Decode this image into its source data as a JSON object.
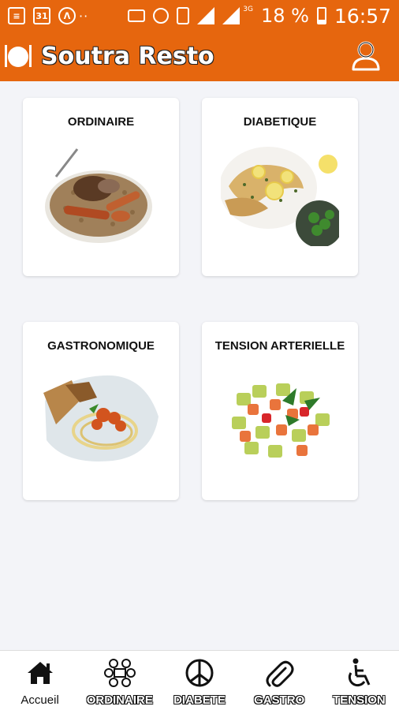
{
  "status_bar": {
    "calendar_day": "31",
    "signal_label": "3G",
    "battery_percent": "18 %",
    "time": "16:57"
  },
  "app_bar": {
    "title": "Soutra Resto",
    "bg_color": "#e6660e"
  },
  "categories": [
    {
      "label": "ORDINAIRE",
      "icon": "couscous-image"
    },
    {
      "label": "DIABETIQUE",
      "icon": "chicken-piccata-image"
    },
    {
      "label": "GASTRONOMIQUE",
      "icon": "pasta-shrimp-image"
    },
    {
      "label": "TENSION ARTERIELLE",
      "icon": "avocado-salad-image"
    }
  ],
  "bottom_nav": [
    {
      "label": "Accueil",
      "icon": "home-icon"
    },
    {
      "label": "ORDINAIRE",
      "icon": "people-table-icon"
    },
    {
      "label": "DIABETE",
      "icon": "peace-icon"
    },
    {
      "label": "GASTRO",
      "icon": "paperclip-icon"
    },
    {
      "label": "TENSION",
      "icon": "wheelchair-icon"
    }
  ]
}
